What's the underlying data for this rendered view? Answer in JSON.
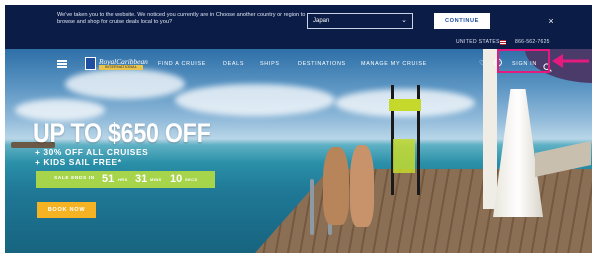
{
  "banner": {
    "message": "We've taken you to the website. We noticed you currently are in Choose another country or region to browse and shop for cruise deals local to you?",
    "country_selected": "Japan",
    "continue_label": "CONTINUE",
    "close_glyph": "×"
  },
  "utility": {
    "country": "UNITED STATES",
    "phone": "866-562-7625"
  },
  "nav": {
    "menu_icon": "hamburger-icon",
    "logo_text": "RoyalCaribbean",
    "logo_sub": "INTERNATIONAL",
    "links": [
      "FIND A CRUISE",
      "DEALS",
      "SHIPS",
      "DESTINATIONS",
      "MANAGE MY CRUISE"
    ],
    "favorites_icon": "heart-icon",
    "account_icon": "user-icon",
    "signin_label": "SIGN IN",
    "search_icon": "search-icon"
  },
  "promo": {
    "headline": "UP TO $650 OFF",
    "line1": "+ 30% OFF ALL CRUISES",
    "line2": "+ KIDS SAIL FREE*",
    "countdown": {
      "label": "SALE ENDS IN",
      "hours": "51",
      "hours_unit": "HRS",
      "mins": "31",
      "mins_unit": "MINS",
      "secs": "10",
      "secs_unit": "SECS"
    },
    "book_label": "BOOK NOW"
  },
  "colors": {
    "navy": "#0b1c46",
    "countdown_green": "#a6d44a",
    "book_orange": "#f5b324",
    "highlight_pink": "#e6197f"
  }
}
